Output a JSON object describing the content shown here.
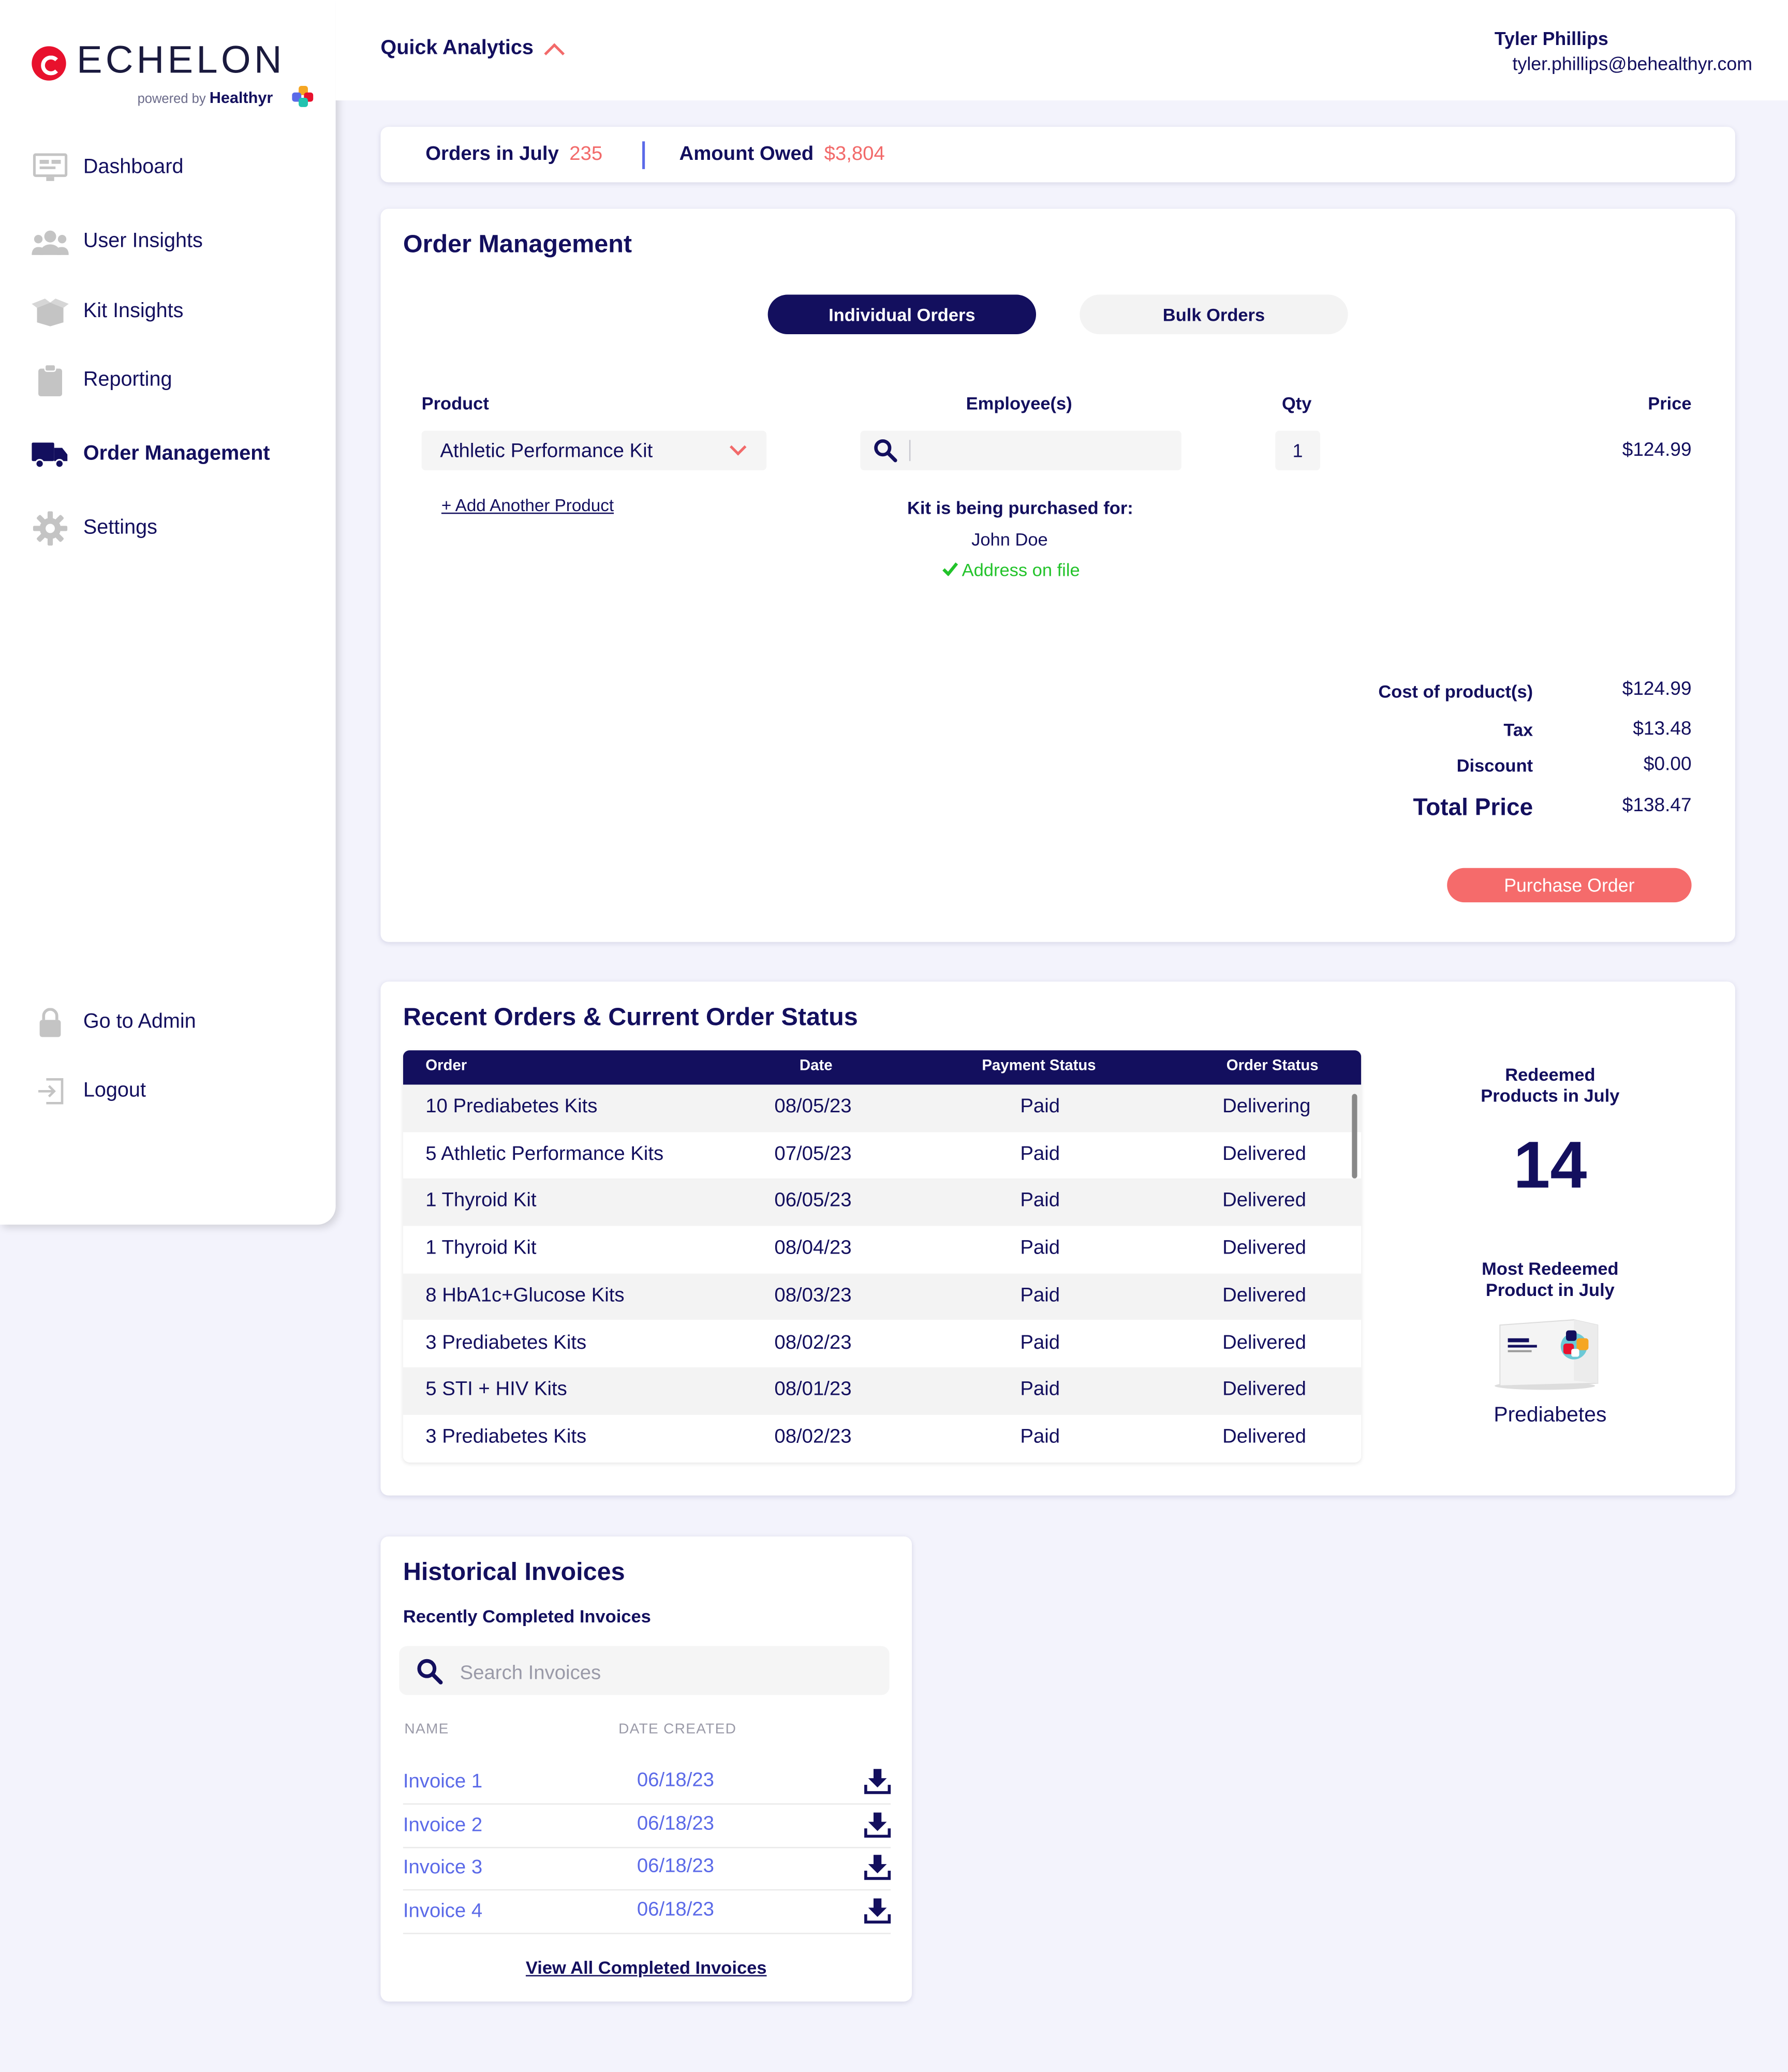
{
  "colors": {
    "navy": "#130f5e",
    "accent": "#f26a6a",
    "link": "#5b6ae8",
    "success": "#22c32a",
    "brand_red": "#e8112d"
  },
  "logo": {
    "wordmark": "ECHELON",
    "powered_by": "powered by",
    "partner": "Healthyr"
  },
  "sidebar": {
    "items": [
      {
        "label": "Dashboard",
        "icon": "monitor-icon"
      },
      {
        "label": "User Insights",
        "icon": "users-icon"
      },
      {
        "label": "Kit Insights",
        "icon": "box-icon"
      },
      {
        "label": "Reporting",
        "icon": "clipboard-icon"
      },
      {
        "label": "Order Management",
        "icon": "truck-icon",
        "active": true
      },
      {
        "label": "Settings",
        "icon": "gear-icon"
      }
    ],
    "bottom": [
      {
        "label": "Go to Admin",
        "icon": "lock-icon"
      },
      {
        "label": "Logout",
        "icon": "logout-icon"
      }
    ]
  },
  "header": {
    "quick_analytics": "Quick Analytics",
    "user_name": "Tyler Phillips",
    "user_email": "tyler.phillips@behealthyr.com"
  },
  "summary": {
    "orders_label": "Orders in July",
    "orders_value": "235",
    "owed_label": "Amount Owed",
    "owed_value": "$3,804"
  },
  "order_management": {
    "title": "Order Management",
    "tabs": [
      {
        "label": "Individual Orders",
        "active": true
      },
      {
        "label": "Bulk Orders",
        "active": false
      }
    ],
    "columns": {
      "product": "Product",
      "employees": "Employee(s)",
      "qty": "Qty",
      "price": "Price"
    },
    "product_selected": "Athletic Performance Kit",
    "employee_search": "",
    "qty": "1",
    "price": "$124.99",
    "add_product": "+ Add Another Product",
    "purchased_for_label": "Kit is being purchased for:",
    "purchased_for_name": "John Doe",
    "address_status": "Address on file",
    "totals": [
      {
        "label": "Cost of product(s)",
        "value": "$124.99"
      },
      {
        "label": "Tax",
        "value": "$13.48"
      },
      {
        "label": "Discount",
        "value": "$0.00"
      },
      {
        "label": "Total Price",
        "value": "$138.47"
      }
    ],
    "purchase_button": "Purchase Order"
  },
  "recent_orders": {
    "title": "Recent Orders & Current Order Status",
    "columns": [
      "Order",
      "Date",
      "Payment Status",
      "Order Status"
    ],
    "rows": [
      [
        "10 Prediabetes Kits",
        "08/05/23",
        "Paid",
        "Delivering"
      ],
      [
        "5 Athletic Performance Kits",
        "07/05/23",
        "Paid",
        "Delivered"
      ],
      [
        "1 Thyroid Kit",
        "06/05/23",
        "Paid",
        "Delivered"
      ],
      [
        "1 Thyroid Kit",
        "08/04/23",
        "Paid",
        "Delivered"
      ],
      [
        "8 HbA1c+Glucose Kits",
        "08/03/23",
        "Paid",
        "Delivered"
      ],
      [
        "3 Prediabetes Kits",
        "08/02/23",
        "Paid",
        "Delivered"
      ],
      [
        "5 STI + HIV Kits",
        "08/01/23",
        "Paid",
        "Delivered"
      ],
      [
        "3 Prediabetes Kits",
        "08/02/23",
        "Paid",
        "Delivered"
      ]
    ],
    "redeemed_label_1": "Redeemed",
    "redeemed_label_2": "Products in July",
    "redeemed_value": "14",
    "most_label_1": "Most Redeemed",
    "most_label_2": "Product in July",
    "most_product": "Prediabetes"
  },
  "invoices": {
    "title": "Historical Invoices",
    "subtitle": "Recently Completed Invoices",
    "search_placeholder": "Search Invoices",
    "col_name": "NAME",
    "col_date": "DATE CREATED",
    "rows": [
      {
        "name": "Invoice 1",
        "date": "06/18/23"
      },
      {
        "name": "Invoice 2",
        "date": "06/18/23"
      },
      {
        "name": "Invoice 3",
        "date": "06/18/23"
      },
      {
        "name": "Invoice 4",
        "date": "06/18/23"
      }
    ],
    "view_all": "View All Completed Invoices"
  }
}
